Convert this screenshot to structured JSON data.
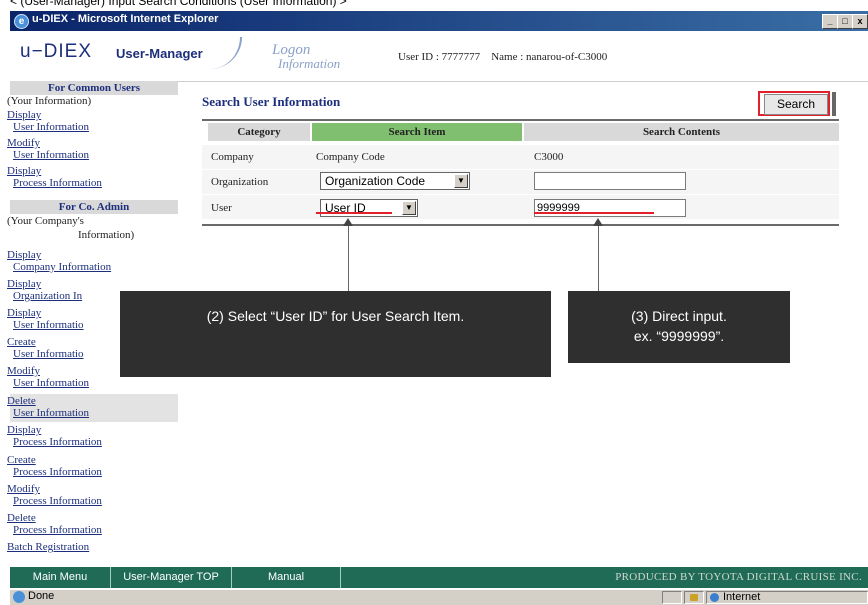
{
  "caption": "< (User-Manager) Input Search Conditions (User Information) >",
  "window": {
    "title": "u-DIEX - Microsoft Internet Explorer",
    "buttons": [
      "_",
      "□",
      "x"
    ]
  },
  "header": {
    "logo": "u−DIEX",
    "subtitle": "User-Manager",
    "logon_info_1": "Logon",
    "logon_info_2": "Information",
    "user_id": "User ID : 7777777",
    "user_name": "Name : nanarou-of-C3000"
  },
  "sidebar": {
    "common_heading": "For Common Users",
    "common_note": "(Your Information)",
    "common_links": [
      [
        "Display",
        "User Information"
      ],
      [
        "Modify",
        "User Information"
      ],
      [
        "Display",
        "Process Information"
      ]
    ],
    "admin_heading": "For Co. Admin",
    "admin_note_1": "(Your Company's",
    "admin_note_2": "Information)",
    "admin_links": [
      [
        "Display",
        "Company Information"
      ],
      [
        "Display",
        "Organization In"
      ],
      [
        "Display",
        "User Informatio"
      ],
      [
        "Create",
        "User Informatio"
      ],
      [
        "Modify",
        "User Information"
      ],
      [
        "Delete",
        "User Information"
      ],
      [
        "Display",
        "Process Information"
      ],
      [
        "Create",
        "Process Information"
      ],
      [
        "Modify",
        "Process Information"
      ],
      [
        "Delete",
        "Process Information"
      ]
    ],
    "batch": "Batch Registration"
  },
  "main": {
    "title": "Search User Information",
    "search_button": "Search",
    "columns": [
      "Category",
      "Search Item",
      "Search Contents"
    ],
    "rows": [
      {
        "category": "Company",
        "item": "Company Code",
        "contents": "C3000"
      },
      {
        "category": "Organization",
        "item": "Organization Code",
        "contents": ""
      },
      {
        "category": "User",
        "item": "User ID",
        "contents": "9999999"
      }
    ]
  },
  "callouts": {
    "step2": "(2) Select “User ID” for User Search Item.",
    "step3_line1": "(3) Direct input.",
    "step3_line2": "ex. “9999999”."
  },
  "bottom_nav": {
    "items": [
      "Main Menu",
      "User-Manager TOP",
      "Manual"
    ],
    "produced_by": "PRODUCED BY TOYOTA DIGITAL CRUISE INC."
  },
  "status": {
    "text": "Done",
    "zone": "Internet"
  },
  "colors": {
    "accent": "#1d2f7c",
    "highlight": "#e2202b",
    "nav": "#1f6b55",
    "table_header": "#7fbf6f"
  }
}
